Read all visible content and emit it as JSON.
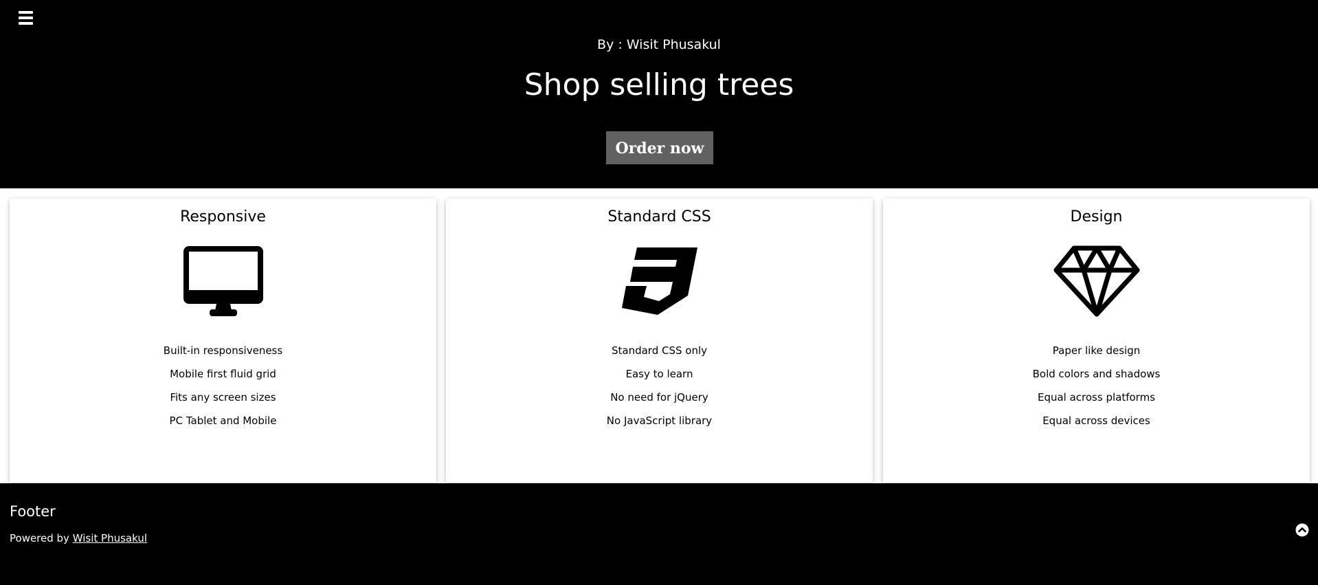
{
  "header": {
    "menu_icon": "hamburger-icon",
    "byline": "By : Wisit Phusakul",
    "title": "Shop selling trees",
    "order_button": "Order now"
  },
  "cards": [
    {
      "title": "Responsive",
      "icon": "desktop-monitor-icon",
      "items": [
        "Built-in responsiveness",
        "Mobile first fluid grid",
        "Fits any screen sizes",
        "PC Tablet and Mobile"
      ]
    },
    {
      "title": "Standard CSS",
      "icon": "css3-icon",
      "items": [
        "Standard CSS only",
        "Easy to learn",
        "No need for jQuery",
        "No JavaScript library"
      ]
    },
    {
      "title": "Design",
      "icon": "diamond-icon",
      "items": [
        "Paper like design",
        "Bold colors and shadows",
        "Equal across platforms",
        "Equal across devices"
      ]
    }
  ],
  "footer": {
    "heading": "Footer",
    "powered_by": "Powered by",
    "author_link": "Wisit Phusakul",
    "top_icon": "chevron-up-circle-icon"
  },
  "colors": {
    "header_bg": "#000000",
    "button_bg": "#616161",
    "card_bg": "#ffffff",
    "footer_bg": "#000000"
  }
}
